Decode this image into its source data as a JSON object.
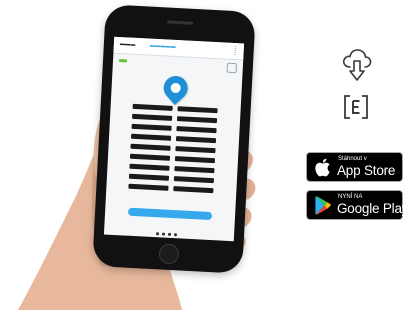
{
  "app_store": {
    "small_label": "Stáhnout v",
    "big_label": "App Store"
  },
  "google_play": {
    "small_label": "NYNÍ NA",
    "big_label": "Google Play"
  },
  "icons": {
    "cloud": "cloud-download-icon",
    "e_app": "e-app-icon",
    "apple": "apple-logo-icon",
    "play": "google-play-logo-icon",
    "pin": "location-pin-icon"
  },
  "colors": {
    "accent_blue": "#2fa0e0",
    "badge_bg": "#000000"
  }
}
